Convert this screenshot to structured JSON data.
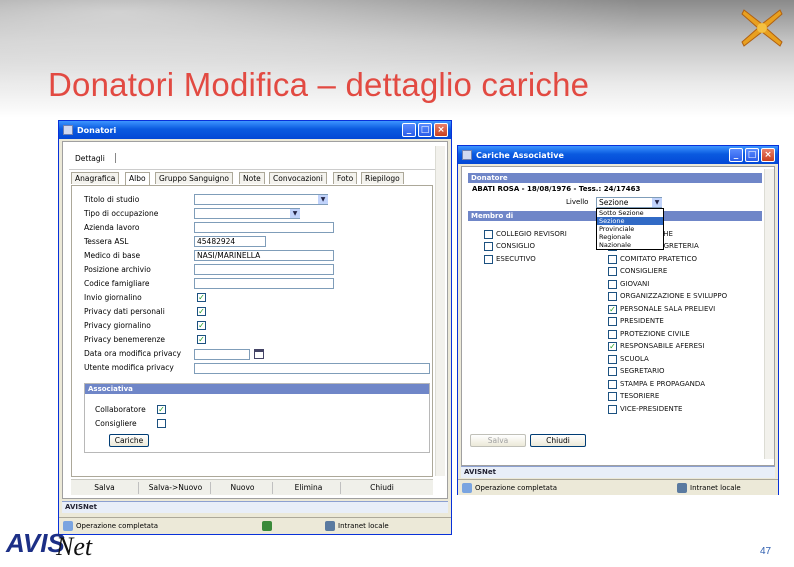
{
  "slide": {
    "title": "Donatori Modifica – dettaglio cariche",
    "page_number": "47",
    "brand_a": "AVIS",
    "brand_net": "Net",
    "brand_red": "#e24a42"
  },
  "window_donatori": {
    "title": "Donatori",
    "section_label": "Dettagli",
    "tabs": [
      "Anagrafica",
      "Albo",
      "Gruppo Sanguigno",
      "Note",
      "Convocazioni",
      "Foto",
      "Riepilogo"
    ],
    "active_tab": "Albo",
    "fields": [
      {
        "label": "Titolo di studio",
        "type": "select",
        "value": ""
      },
      {
        "label": "Tipo di occupazione",
        "type": "select",
        "value": ""
      },
      {
        "label": "Azienda lavoro",
        "type": "text",
        "value": ""
      },
      {
        "label": "Tessera ASL",
        "type": "text",
        "value": "45482924"
      },
      {
        "label": "Medico di base",
        "type": "text",
        "value": "NASI/MARINELLA"
      },
      {
        "label": "Posizione archivio",
        "type": "text",
        "value": ""
      },
      {
        "label": "Codice famigliare",
        "type": "text",
        "value": ""
      },
      {
        "label": "Invio giornalino",
        "type": "check",
        "checked": true
      },
      {
        "label": "Privacy dati personali",
        "type": "check",
        "checked": true
      },
      {
        "label": "Privacy giornalino",
        "type": "check",
        "checked": true
      },
      {
        "label": "Privacy benemerenze",
        "type": "check",
        "checked": true
      },
      {
        "label": "Data ora modifica privacy",
        "type": "date",
        "value": ""
      },
      {
        "label": "Utente modifica privacy",
        "type": "text",
        "value": ""
      }
    ],
    "associativa": {
      "header": "Associativa",
      "collaboratore_label": "Collaboratore",
      "collaboratore_checked": true,
      "consigliere_label": "Consigliere",
      "consigliere_checked": false,
      "cariche_button": "Cariche"
    },
    "bottom_buttons": [
      "Salva",
      "Salva->Nuovo",
      "Nuovo",
      "Elimina",
      "Chiudi"
    ],
    "footer_app": "AVISNet",
    "status_text": "Operazione completata",
    "status_zone": "Intranet locale"
  },
  "window_cariche": {
    "title": "Cariche Associative",
    "donatore_header": "Donatore",
    "donatore_info": "ABATI ROSA - 18/08/1976 - Tess.: 24/17463",
    "livello_label": "Livello",
    "livello_value": "Sezione",
    "livello_options": [
      "Sotto Sezione",
      "Sezione",
      "Provinciale",
      "Regionale",
      "Nazionale"
    ],
    "livello_selected": "Sezione",
    "membro_header": "Membro di",
    "left_list": [
      {
        "label": "COLLEGIO REVISORI",
        "checked": false
      },
      {
        "label": "CONSIGLIO",
        "checked": false
      },
      {
        "label": "ESECUTIVO",
        "checked": false
      }
    ],
    "right_list": [
      {
        "label": "INFORMATICHE",
        "checked": false
      },
      {
        "label": "RETTORE SEGRETERIA",
        "checked": false
      },
      {
        "label": "COMITATO PRATETICO",
        "checked": false
      },
      {
        "label": "CONSIGLIERE",
        "checked": false
      },
      {
        "label": "GIOVANI",
        "checked": false
      },
      {
        "label": "ORGANIZZAZIONE E SVILUPPO",
        "checked": false
      },
      {
        "label": "PERSONALE SALA PRELIEVI",
        "checked": true
      },
      {
        "label": "PRESIDENTE",
        "checked": false
      },
      {
        "label": "PROTEZIONE CIVILE",
        "checked": false
      },
      {
        "label": "RESPONSABILE AFERESI",
        "checked": true
      },
      {
        "label": "SCUOLA",
        "checked": false
      },
      {
        "label": "SEGRETARIO",
        "checked": false
      },
      {
        "label": "STAMPA E PROPAGANDA",
        "checked": false
      },
      {
        "label": "TESORIERE",
        "checked": false
      },
      {
        "label": "VICE-PRESIDENTE",
        "checked": false
      }
    ],
    "salva_button": "Salva",
    "chiudi_button": "Chiudi",
    "footer_app": "AVISNet",
    "status_text": "Operazione completata",
    "status_zone": "Intranet locale"
  },
  "icons": {
    "window": "window-icon",
    "minimize": "minimize-icon",
    "maximize": "maximize-icon",
    "close": "close-icon",
    "calendar": "calendar-icon",
    "intranet": "intranet-icon",
    "page": "page-icon",
    "logo": "x-logo-icon"
  }
}
